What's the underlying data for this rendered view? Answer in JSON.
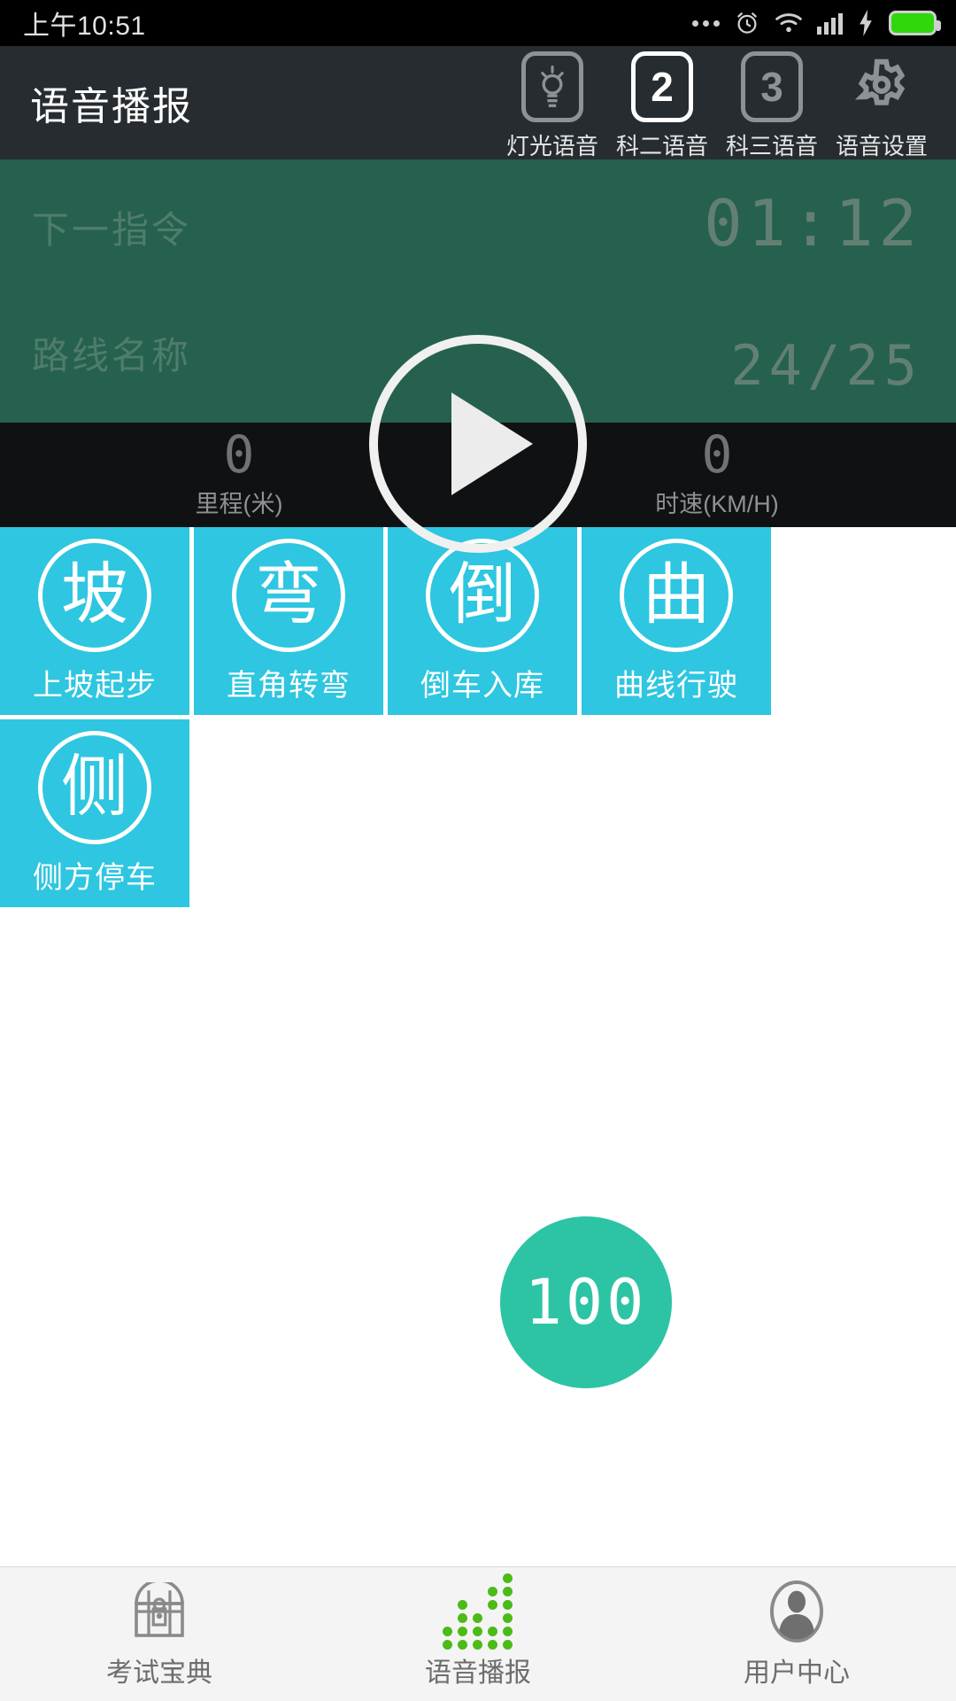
{
  "statusbar": {
    "time": "上午10:51",
    "icons": [
      "more-dots",
      "alarm-clock",
      "wifi",
      "signal",
      "charging-bolt",
      "battery"
    ]
  },
  "header": {
    "title": "语音播报",
    "nav": [
      {
        "icon": "lightbulb-icon",
        "badge": "",
        "label": "灯光语音",
        "active": false
      },
      {
        "icon": "number-2-icon",
        "badge": "2",
        "label": "科二语音",
        "active": true
      },
      {
        "icon": "number-3-icon",
        "badge": "3",
        "label": "科三语音",
        "active": false
      },
      {
        "icon": "gear-icon",
        "badge": "",
        "label": "语音设置",
        "active": false
      }
    ]
  },
  "player": {
    "next_command_label": "下一指令",
    "route_name_label": "路线名称",
    "timer": "01:12",
    "counter": "24/25",
    "play_button": "play-icon"
  },
  "metrics": [
    {
      "value": "0",
      "label": "里程(米)"
    },
    {
      "value": "0",
      "label": "时速(KM/H)"
    }
  ],
  "tiles": [
    {
      "glyph": "坡",
      "label": "上坡起步"
    },
    {
      "glyph": "弯",
      "label": "直角转弯"
    },
    {
      "glyph": "倒",
      "label": "倒车入库"
    },
    {
      "glyph": "曲",
      "label": "曲线行驶"
    },
    {
      "glyph": "侧",
      "label": "侧方停车"
    }
  ],
  "score_button": {
    "value": "100"
  },
  "tabbar": [
    {
      "icon": "treasure-chest-icon",
      "label": "考试宝典",
      "active": false
    },
    {
      "icon": "equalizer-icon",
      "label": "语音播报",
      "active": true
    },
    {
      "icon": "user-avatar-icon",
      "label": "用户中心",
      "active": false
    }
  ],
  "colors": {
    "accent_cyan": "#2ec6e0",
    "player_green": "#26614f",
    "score_green": "#2cc4a4",
    "header_dark": "#262c30",
    "eq_green": "#4cbb17"
  }
}
